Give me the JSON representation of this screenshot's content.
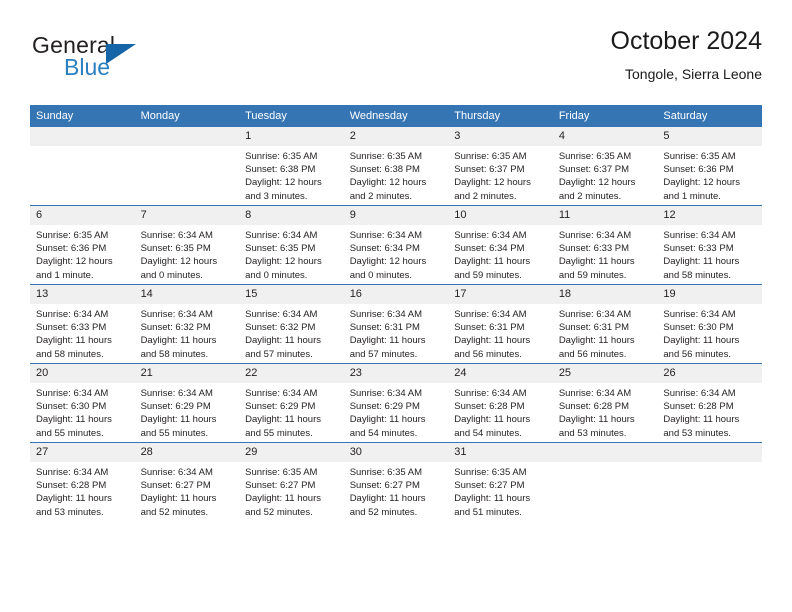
{
  "brand": {
    "name_primary": "General",
    "name_secondary": "Blue",
    "triangle_color": "#1565a8",
    "secondary_color": "#2a7fc1"
  },
  "header": {
    "title": "October 2024",
    "subtitle": "Tongole, Sierra Leone"
  },
  "theme": {
    "header_bg": "#3575b4",
    "daynum_bg": "#f0f0f0",
    "grid_line": "#3575b4"
  },
  "weekday_headers": [
    "Sunday",
    "Monday",
    "Tuesday",
    "Wednesday",
    "Thursday",
    "Friday",
    "Saturday"
  ],
  "weeks": [
    [
      {
        "day": "",
        "sunrise": "",
        "sunset": "",
        "daylight_line1": "",
        "daylight_line2": ""
      },
      {
        "day": "",
        "sunrise": "",
        "sunset": "",
        "daylight_line1": "",
        "daylight_line2": ""
      },
      {
        "day": "1",
        "sunrise": "Sunrise: 6:35 AM",
        "sunset": "Sunset: 6:38 PM",
        "daylight_line1": "Daylight: 12 hours",
        "daylight_line2": "and 3 minutes."
      },
      {
        "day": "2",
        "sunrise": "Sunrise: 6:35 AM",
        "sunset": "Sunset: 6:38 PM",
        "daylight_line1": "Daylight: 12 hours",
        "daylight_line2": "and 2 minutes."
      },
      {
        "day": "3",
        "sunrise": "Sunrise: 6:35 AM",
        "sunset": "Sunset: 6:37 PM",
        "daylight_line1": "Daylight: 12 hours",
        "daylight_line2": "and 2 minutes."
      },
      {
        "day": "4",
        "sunrise": "Sunrise: 6:35 AM",
        "sunset": "Sunset: 6:37 PM",
        "daylight_line1": "Daylight: 12 hours",
        "daylight_line2": "and 2 minutes."
      },
      {
        "day": "5",
        "sunrise": "Sunrise: 6:35 AM",
        "sunset": "Sunset: 6:36 PM",
        "daylight_line1": "Daylight: 12 hours",
        "daylight_line2": "and 1 minute."
      }
    ],
    [
      {
        "day": "6",
        "sunrise": "Sunrise: 6:35 AM",
        "sunset": "Sunset: 6:36 PM",
        "daylight_line1": "Daylight: 12 hours",
        "daylight_line2": "and 1 minute."
      },
      {
        "day": "7",
        "sunrise": "Sunrise: 6:34 AM",
        "sunset": "Sunset: 6:35 PM",
        "daylight_line1": "Daylight: 12 hours",
        "daylight_line2": "and 0 minutes."
      },
      {
        "day": "8",
        "sunrise": "Sunrise: 6:34 AM",
        "sunset": "Sunset: 6:35 PM",
        "daylight_line1": "Daylight: 12 hours",
        "daylight_line2": "and 0 minutes."
      },
      {
        "day": "9",
        "sunrise": "Sunrise: 6:34 AM",
        "sunset": "Sunset: 6:34 PM",
        "daylight_line1": "Daylight: 12 hours",
        "daylight_line2": "and 0 minutes."
      },
      {
        "day": "10",
        "sunrise": "Sunrise: 6:34 AM",
        "sunset": "Sunset: 6:34 PM",
        "daylight_line1": "Daylight: 11 hours",
        "daylight_line2": "and 59 minutes."
      },
      {
        "day": "11",
        "sunrise": "Sunrise: 6:34 AM",
        "sunset": "Sunset: 6:33 PM",
        "daylight_line1": "Daylight: 11 hours",
        "daylight_line2": "and 59 minutes."
      },
      {
        "day": "12",
        "sunrise": "Sunrise: 6:34 AM",
        "sunset": "Sunset: 6:33 PM",
        "daylight_line1": "Daylight: 11 hours",
        "daylight_line2": "and 58 minutes."
      }
    ],
    [
      {
        "day": "13",
        "sunrise": "Sunrise: 6:34 AM",
        "sunset": "Sunset: 6:33 PM",
        "daylight_line1": "Daylight: 11 hours",
        "daylight_line2": "and 58 minutes."
      },
      {
        "day": "14",
        "sunrise": "Sunrise: 6:34 AM",
        "sunset": "Sunset: 6:32 PM",
        "daylight_line1": "Daylight: 11 hours",
        "daylight_line2": "and 58 minutes."
      },
      {
        "day": "15",
        "sunrise": "Sunrise: 6:34 AM",
        "sunset": "Sunset: 6:32 PM",
        "daylight_line1": "Daylight: 11 hours",
        "daylight_line2": "and 57 minutes."
      },
      {
        "day": "16",
        "sunrise": "Sunrise: 6:34 AM",
        "sunset": "Sunset: 6:31 PM",
        "daylight_line1": "Daylight: 11 hours",
        "daylight_line2": "and 57 minutes."
      },
      {
        "day": "17",
        "sunrise": "Sunrise: 6:34 AM",
        "sunset": "Sunset: 6:31 PM",
        "daylight_line1": "Daylight: 11 hours",
        "daylight_line2": "and 56 minutes."
      },
      {
        "day": "18",
        "sunrise": "Sunrise: 6:34 AM",
        "sunset": "Sunset: 6:31 PM",
        "daylight_line1": "Daylight: 11 hours",
        "daylight_line2": "and 56 minutes."
      },
      {
        "day": "19",
        "sunrise": "Sunrise: 6:34 AM",
        "sunset": "Sunset: 6:30 PM",
        "daylight_line1": "Daylight: 11 hours",
        "daylight_line2": "and 56 minutes."
      }
    ],
    [
      {
        "day": "20",
        "sunrise": "Sunrise: 6:34 AM",
        "sunset": "Sunset: 6:30 PM",
        "daylight_line1": "Daylight: 11 hours",
        "daylight_line2": "and 55 minutes."
      },
      {
        "day": "21",
        "sunrise": "Sunrise: 6:34 AM",
        "sunset": "Sunset: 6:29 PM",
        "daylight_line1": "Daylight: 11 hours",
        "daylight_line2": "and 55 minutes."
      },
      {
        "day": "22",
        "sunrise": "Sunrise: 6:34 AM",
        "sunset": "Sunset: 6:29 PM",
        "daylight_line1": "Daylight: 11 hours",
        "daylight_line2": "and 55 minutes."
      },
      {
        "day": "23",
        "sunrise": "Sunrise: 6:34 AM",
        "sunset": "Sunset: 6:29 PM",
        "daylight_line1": "Daylight: 11 hours",
        "daylight_line2": "and 54 minutes."
      },
      {
        "day": "24",
        "sunrise": "Sunrise: 6:34 AM",
        "sunset": "Sunset: 6:28 PM",
        "daylight_line1": "Daylight: 11 hours",
        "daylight_line2": "and 54 minutes."
      },
      {
        "day": "25",
        "sunrise": "Sunrise: 6:34 AM",
        "sunset": "Sunset: 6:28 PM",
        "daylight_line1": "Daylight: 11 hours",
        "daylight_line2": "and 53 minutes."
      },
      {
        "day": "26",
        "sunrise": "Sunrise: 6:34 AM",
        "sunset": "Sunset: 6:28 PM",
        "daylight_line1": "Daylight: 11 hours",
        "daylight_line2": "and 53 minutes."
      }
    ],
    [
      {
        "day": "27",
        "sunrise": "Sunrise: 6:34 AM",
        "sunset": "Sunset: 6:28 PM",
        "daylight_line1": "Daylight: 11 hours",
        "daylight_line2": "and 53 minutes."
      },
      {
        "day": "28",
        "sunrise": "Sunrise: 6:34 AM",
        "sunset": "Sunset: 6:27 PM",
        "daylight_line1": "Daylight: 11 hours",
        "daylight_line2": "and 52 minutes."
      },
      {
        "day": "29",
        "sunrise": "Sunrise: 6:35 AM",
        "sunset": "Sunset: 6:27 PM",
        "daylight_line1": "Daylight: 11 hours",
        "daylight_line2": "and 52 minutes."
      },
      {
        "day": "30",
        "sunrise": "Sunrise: 6:35 AM",
        "sunset": "Sunset: 6:27 PM",
        "daylight_line1": "Daylight: 11 hours",
        "daylight_line2": "and 52 minutes."
      },
      {
        "day": "31",
        "sunrise": "Sunrise: 6:35 AM",
        "sunset": "Sunset: 6:27 PM",
        "daylight_line1": "Daylight: 11 hours",
        "daylight_line2": "and 51 minutes."
      },
      {
        "day": "",
        "sunrise": "",
        "sunset": "",
        "daylight_line1": "",
        "daylight_line2": ""
      },
      {
        "day": "",
        "sunrise": "",
        "sunset": "",
        "daylight_line1": "",
        "daylight_line2": ""
      }
    ]
  ]
}
